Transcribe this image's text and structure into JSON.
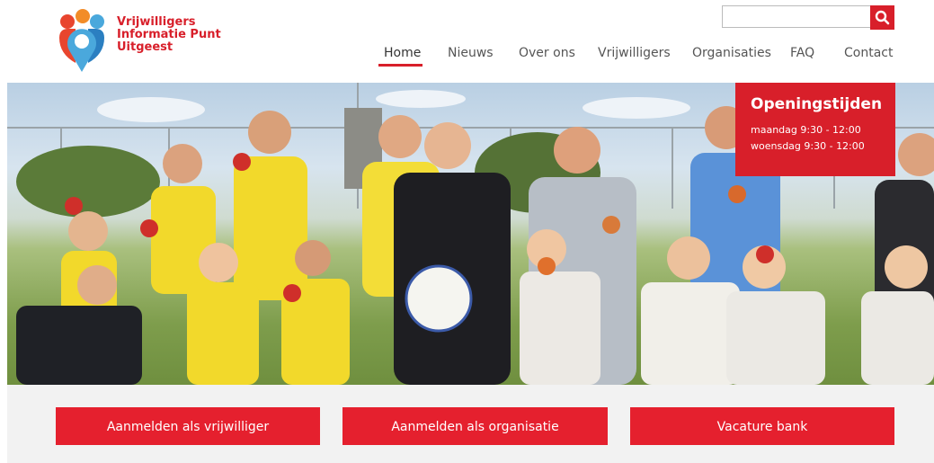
{
  "brand": {
    "line1": "Vrijwilligers",
    "line2": "Informatie Punt",
    "line3": "Uitgeest",
    "color": "#d81f2a",
    "logo_colors": [
      "#e8452e",
      "#f28c28",
      "#4aa8dc",
      "#2b7fc1",
      "#d81f2a"
    ]
  },
  "search": {
    "placeholder": "",
    "icon": "search-icon"
  },
  "nav": {
    "items": [
      {
        "label": "Home",
        "active": true
      },
      {
        "label": "Nieuws"
      },
      {
        "label": "Over ons"
      },
      {
        "label": "Vrijwilligers"
      },
      {
        "label": "Organisaties"
      },
      {
        "label": "FAQ"
      },
      {
        "label": "Contact"
      }
    ]
  },
  "hero": {
    "image": "group-photo-football-kids-with-apples",
    "hours": {
      "title": "Openingstijden",
      "line1": "maandag 9:30 - 12:00",
      "line2": "woensdag 9:30 - 12:00"
    }
  },
  "cta": {
    "buttons": [
      {
        "label": "Aanmelden als vrijwilliger"
      },
      {
        "label": "Aanmelden als organisatie"
      },
      {
        "label": "Vacature bank"
      }
    ],
    "color": "#e5202e"
  }
}
